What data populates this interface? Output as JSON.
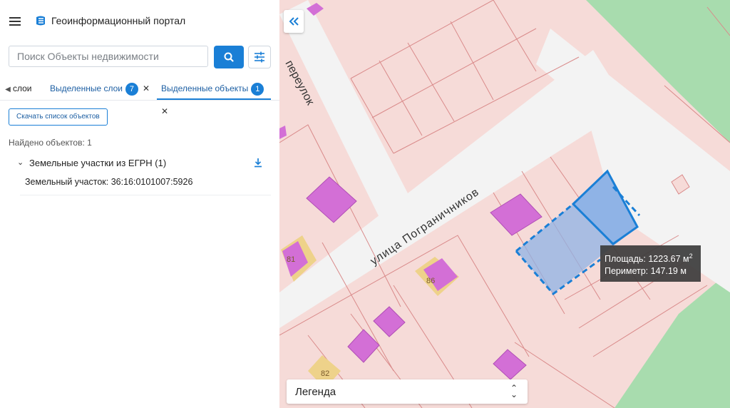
{
  "header": {
    "title": "Геоинформационный портал"
  },
  "search": {
    "placeholder": "Поиск Объекты недвижимости"
  },
  "tabs": {
    "back_label": "слои",
    "layers_label": "Выделенные слои",
    "layers_count": "7",
    "objects_label": "Выделенные объекты",
    "objects_count": "1"
  },
  "actions": {
    "download_list_label": "Скачать список объектов"
  },
  "results": {
    "found_text": "Найдено объектов: 1",
    "group_title": "Земельные участки из ЕГРН (1)",
    "items": [
      {
        "label": "Земельный участок: 36:16:0101007:5926"
      }
    ]
  },
  "map": {
    "street_labels": [
      {
        "text": "переулок"
      },
      {
        "text": "улица Пограничников"
      }
    ],
    "house_numbers": [
      "81",
      "86",
      "82"
    ],
    "measure": {
      "area_label": "Площадь: 1223.67 м",
      "area_sup": "2",
      "perimeter_label": "Периметр: 147.19 м"
    },
    "legend_label": "Легенда"
  },
  "colors": {
    "accent": "#1a7fd6",
    "parcel_fill": "#f6dbd8",
    "parcel_stroke": "#d98a8a",
    "building": "#d36fd6",
    "selected_fill": "#8fb3e6",
    "forest": "#a8dcae"
  },
  "icons": {
    "menu": "menu-icon",
    "logo": "portal-logo-icon",
    "search": "search-icon",
    "filter": "filter-icon",
    "download": "download-icon",
    "collapse": "double-chevron-left-icon"
  }
}
